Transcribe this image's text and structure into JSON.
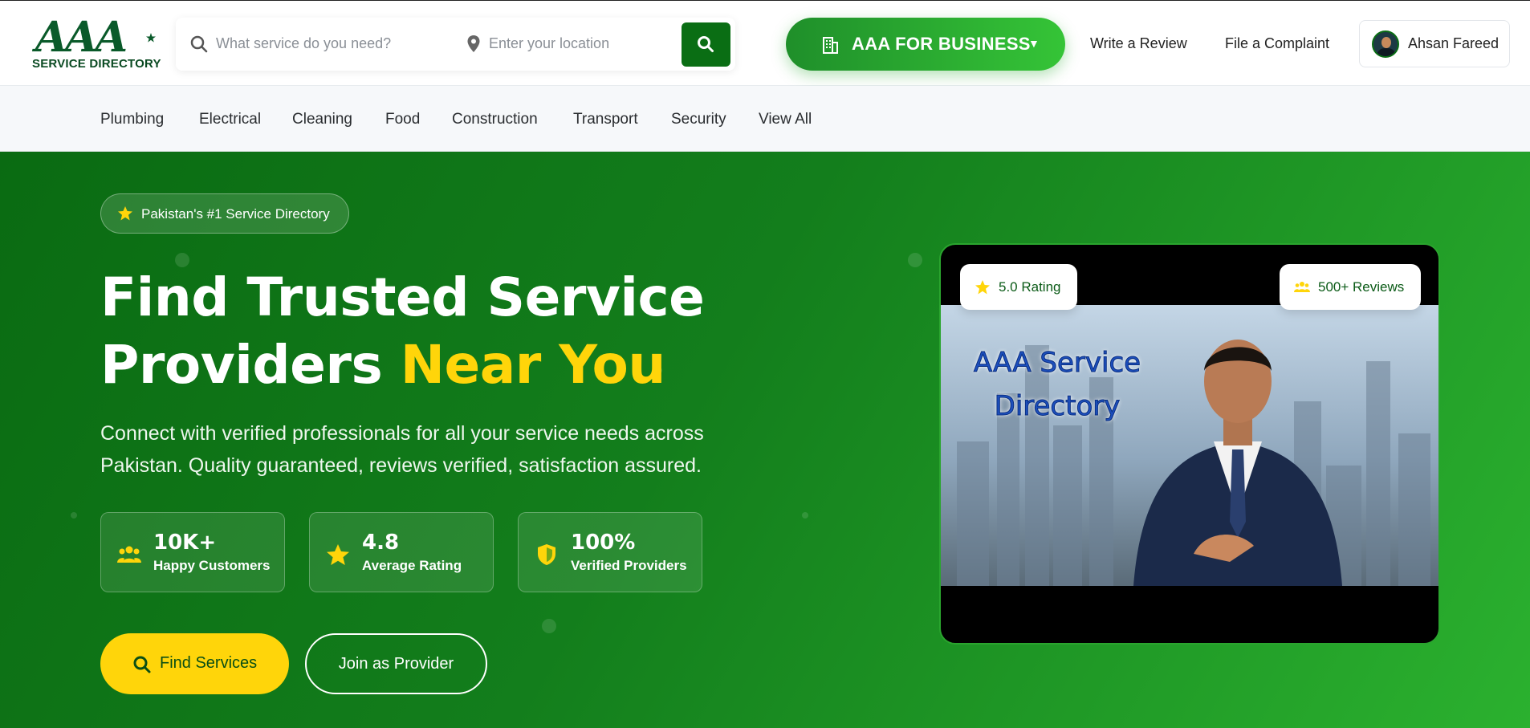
{
  "logo": {
    "mark": "AAA",
    "subtitle": "SERVICE DIRECTORY"
  },
  "search": {
    "service_placeholder": "What service do you need?",
    "location_placeholder": "Enter your location",
    "search_icon": "search-icon",
    "location_icon": "map-pin-icon"
  },
  "business": {
    "label": "AAA FOR BUSINESS",
    "icon": "building-icon",
    "caret": "▼"
  },
  "nav": {
    "write_review": "Write a Review",
    "file_complaint": "File a Complaint"
  },
  "user": {
    "name": "Ahsan Fareed"
  },
  "categories": [
    "Plumbing",
    "Electrical",
    "Cleaning",
    "Food",
    "Construction",
    "Transport",
    "Security",
    "View All"
  ],
  "hero": {
    "badge": "Pakistan's #1 Service Directory",
    "title_line1": "Find Trusted Service",
    "title_line2_plain": "Providers ",
    "title_line2_highlight": "Near You",
    "subtitle": "Connect with verified professionals for all your service needs across Pakistan. Quality guaranteed, reviews verified, satisfaction assured.",
    "stats": [
      {
        "value": "10K+",
        "label": "Happy Customers",
        "icon": "users-icon"
      },
      {
        "value": "4.8",
        "label": "Average Rating",
        "icon": "star-icon"
      },
      {
        "value": "100%",
        "label": "Verified Providers",
        "icon": "shield-icon"
      }
    ],
    "find_button": "Find Services",
    "join_button": "Join as Provider"
  },
  "video": {
    "title_line1": "AAA Service",
    "title_line2": "Directory",
    "rating_pill": "5.0 Rating",
    "reviews_pill": "500+ Reviews"
  },
  "colors": {
    "brand_green": "#0a6e14",
    "accent_yellow": "#ffd50a",
    "business_gradient_start": "#1f8f2a",
    "business_gradient_end": "#35c437"
  }
}
